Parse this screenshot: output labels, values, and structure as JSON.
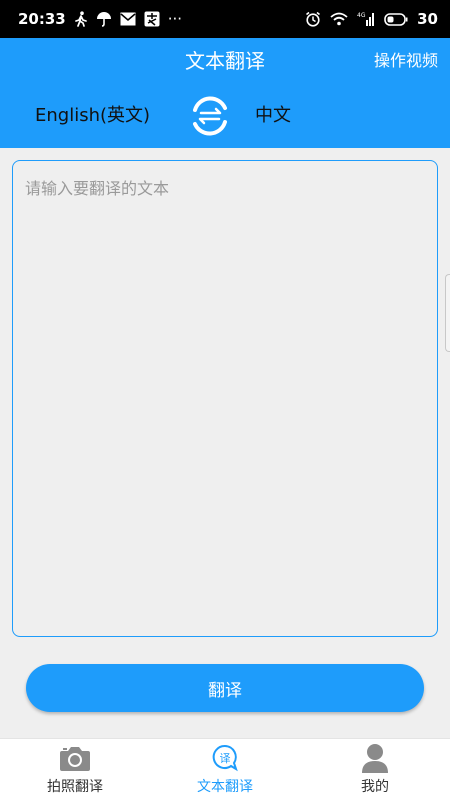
{
  "status_bar": {
    "time": "20:33",
    "battery": "30",
    "network": "4G",
    "more": "···"
  },
  "header": {
    "title": "文本翻译",
    "video_link": "操作视频"
  },
  "languages": {
    "source": "English(英文)",
    "target": "中文",
    "swap_icon": "swap-arrows-icon"
  },
  "input": {
    "placeholder": "请输入要翻译的文本",
    "value": ""
  },
  "translate_button": {
    "label": "翻译"
  },
  "tabs": [
    {
      "label": "拍照翻译",
      "icon": "camera-icon",
      "active": false
    },
    {
      "label": "文本翻译",
      "icon": "translate-bubble-icon",
      "active": true
    },
    {
      "label": "我的",
      "icon": "user-icon",
      "active": false
    }
  ],
  "colors": {
    "accent": "#1e9cfb",
    "background": "#efefef",
    "tab_inactive": "#333333",
    "icon_gray": "#8a8a8a"
  }
}
